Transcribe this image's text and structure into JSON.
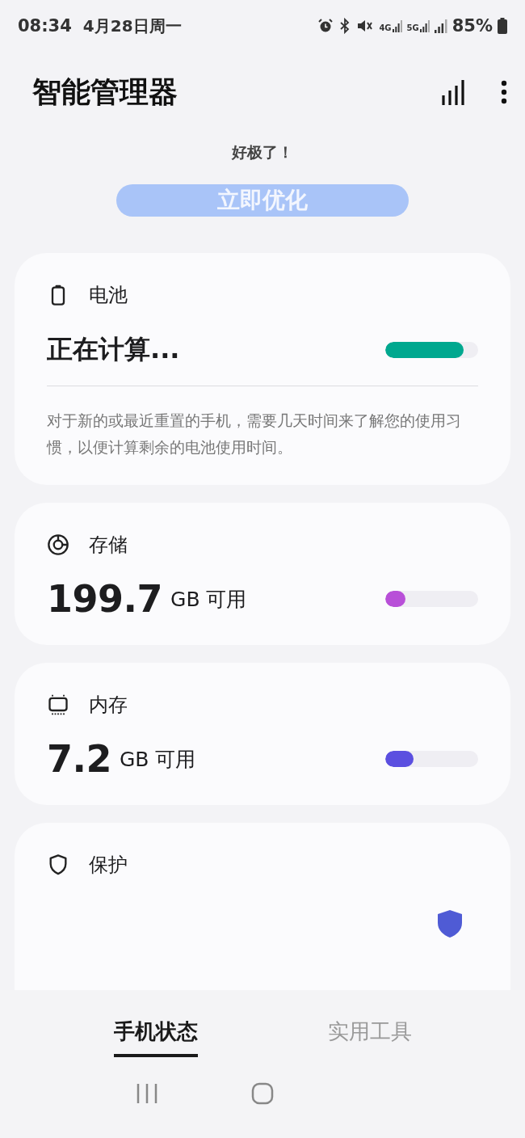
{
  "status_bar": {
    "time": "08:34",
    "date": "4月28日周一",
    "network_labels": [
      "4G",
      "5G"
    ],
    "battery": "85%"
  },
  "header": {
    "title": "智能管理器"
  },
  "summary": {
    "message": "好极了！",
    "button": "立即优化"
  },
  "cards": [
    {
      "kind": "battery",
      "title": "电池",
      "value": "正在计算...",
      "level": 0.84,
      "color": "#00a88f",
      "description": "对于新的或最近重置的手机，需要几天时间来了解您的使用习惯，以便计算剩余的电池使用时间。"
    },
    {
      "kind": "storage",
      "title": "存储",
      "value": "199.7",
      "unit": "GB 可用",
      "level": 0.22,
      "color": "#b84fd8"
    },
    {
      "kind": "memory",
      "title": "内存",
      "value": "7.2",
      "unit": "GB 可用",
      "level": 0.3,
      "color": "#5b4fe0"
    },
    {
      "kind": "protection",
      "title": "保护"
    }
  ],
  "tabs": [
    {
      "label": "手机状态",
      "selected": true
    },
    {
      "label": "实用工具",
      "selected": false
    }
  ]
}
